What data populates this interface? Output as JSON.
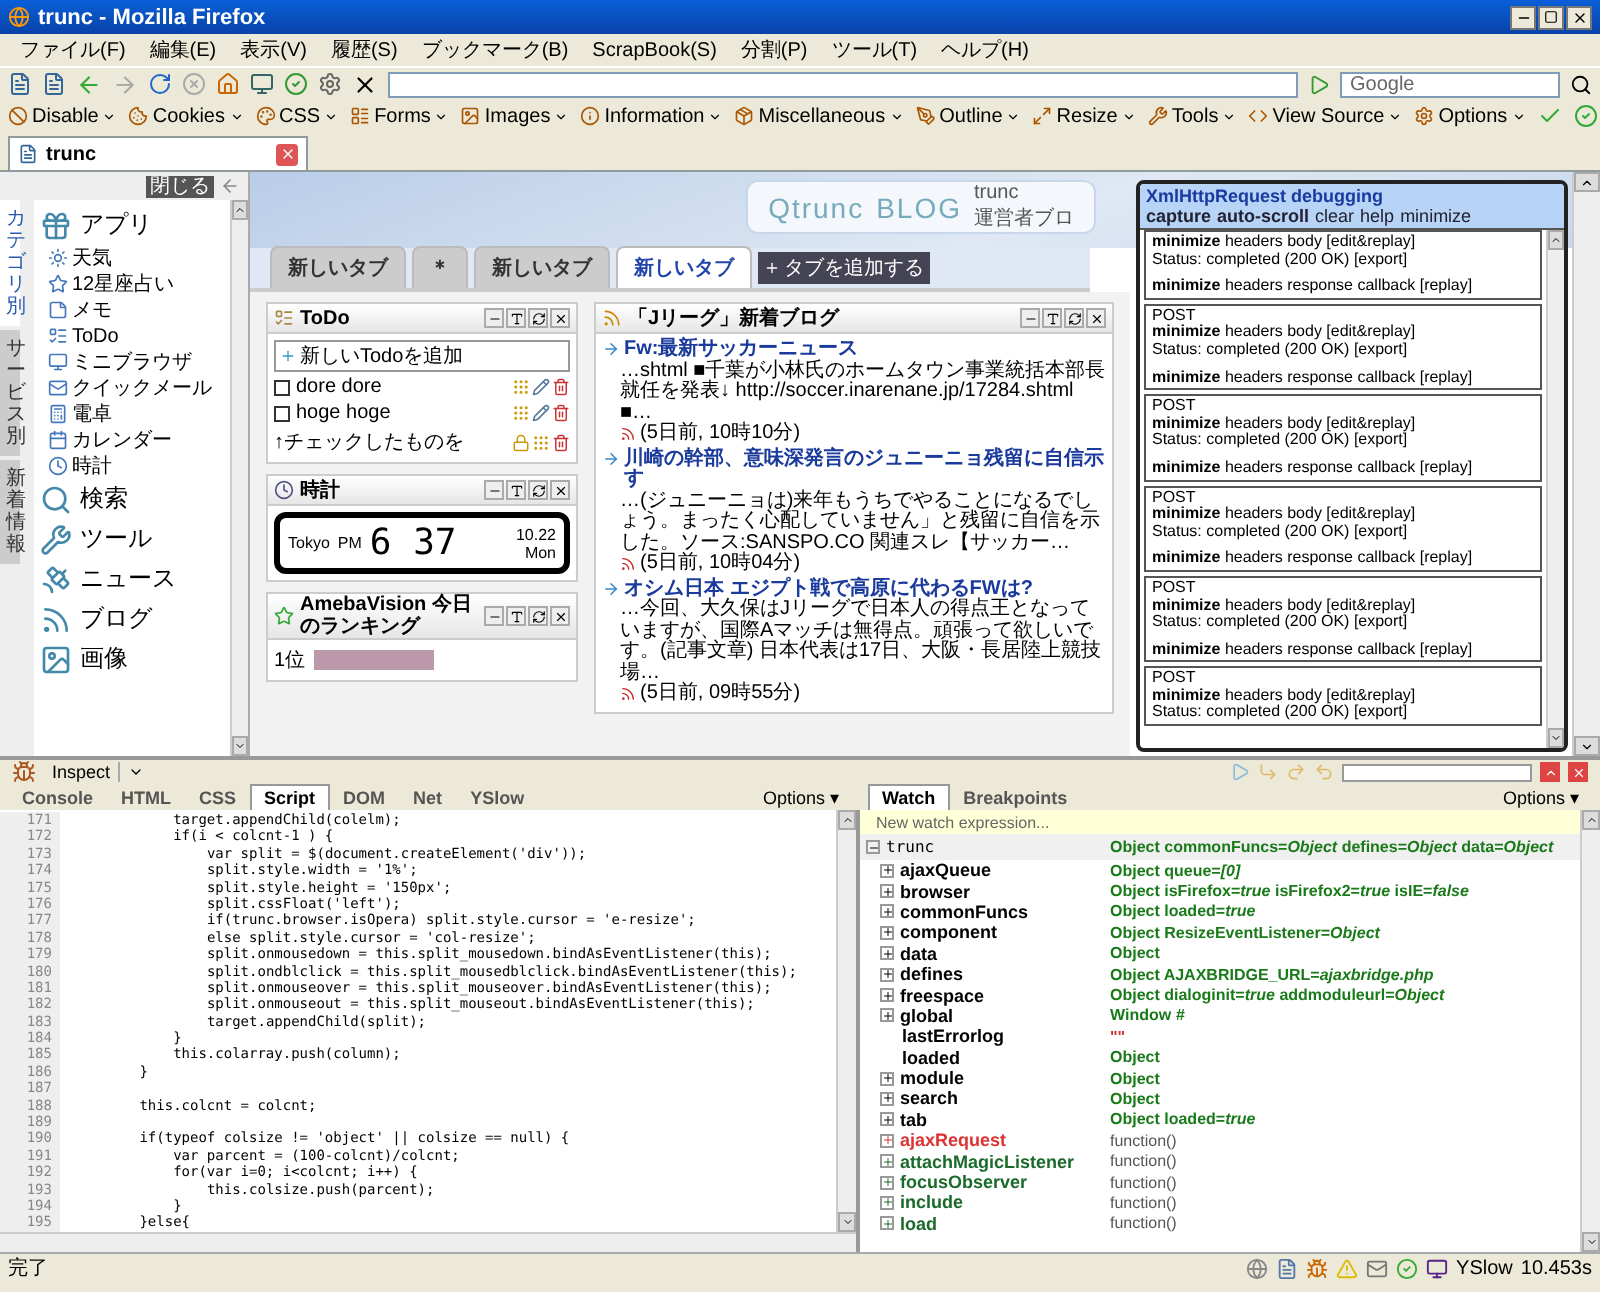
{
  "window": {
    "title": "trunc - Mozilla Firefox"
  },
  "menu": [
    "ファイル(F)",
    "編集(E)",
    "表示(V)",
    "履歴(S)",
    "ブックマーク(B)",
    "ScrapBook(S)",
    "分割(P)",
    "ツール(T)",
    "ヘルプ(H)"
  ],
  "search_box": {
    "placeholder": "Google"
  },
  "dev_toolbar": [
    "Disable",
    "Cookies",
    "CSS",
    "Forms",
    "Images",
    "Information",
    "Miscellaneous",
    "Outline",
    "Resize",
    "Tools",
    "View Source",
    "Options"
  ],
  "browser_tabs": [
    {
      "label": "trunc",
      "selected": true
    }
  ],
  "sidebar": {
    "close_button": "閉じる",
    "tabs": [
      {
        "label": "カテゴリ別",
        "selected": true
      },
      {
        "label": "サービス別",
        "selected": false
      },
      {
        "label": "新着情報",
        "selected": false
      }
    ],
    "sections": [
      {
        "label": "アプリ",
        "children": [
          {
            "label": "天気"
          },
          {
            "label": "12星座占い"
          },
          {
            "label": "メモ"
          },
          {
            "label": "ToDo"
          },
          {
            "label": "ミニブラウザ"
          },
          {
            "label": "クイックメール"
          },
          {
            "label": "電卓"
          },
          {
            "label": "カレンダー"
          },
          {
            "label": "時計"
          }
        ]
      },
      {
        "label": "検索"
      },
      {
        "label": "ツール"
      },
      {
        "label": "ニュース"
      },
      {
        "label": "ブログ"
      },
      {
        "label": "画像"
      }
    ]
  },
  "page": {
    "logo": "Qtrunc",
    "logo_suffix": "BLOG",
    "owner": "trunc",
    "owner_note": "運営者ブロ",
    "tabs": [
      {
        "label": "新しいタブ",
        "selected": false
      },
      {
        "label": "＊",
        "selected": false
      },
      {
        "label": "新しいタブ",
        "selected": false
      },
      {
        "label": "新しいタブ",
        "selected": true
      }
    ],
    "add_tab": "タブを追加する",
    "todo": {
      "title": "ToDo",
      "add": "新しいTodoを追加",
      "items": [
        {
          "label": "dore dore",
          "checked": false
        },
        {
          "label": "hoge hoge",
          "checked": false
        }
      ],
      "footer": "↑チェックしたものを"
    },
    "clock": {
      "title": "時計",
      "city": "Tokyo",
      "ampm": "PM",
      "time": "6 37",
      "date": "10.22",
      "weekday": "Mon"
    },
    "ranking": {
      "title": "AmebaVision 今日のランキング",
      "rank": "1位"
    },
    "blog": {
      "title": "「Jリーグ」新着ブログ",
      "entries": [
        {
          "title": "Fw:最新サッカーニュース",
          "snippet": "…shtml ■千葉が小林氏のホームタウン事業統括本部長就任を発表↓ http://soccer.inarenane.jp/17284.shtml ■…",
          "meta": "(5日前, 10時10分)"
        },
        {
          "title": "川崎の幹部、意味深発言のジュニーニョ残留に自信示す",
          "snippet": "…(ジュニーニョは)来年もうちでやることになるでしょう。まったく心配していません」と残留に自信を示した。ソース:SANSPO.CO 関連スレ【サッカー…",
          "meta": "(5日前, 10時04分)"
        },
        {
          "title": "オシム日本 エジプト戦で高原に代わるFWは?",
          "snippet": "…今回、大久保はJリーグで日本人の得点王となっていますが、国際Aマッチは無得点。頑張って欲しいです。(記事文章) 日本代表は17日、大阪・長居陸上競技場…",
          "meta": "(5日前, 09時55分)"
        }
      ]
    }
  },
  "xhr_panel": {
    "title": "XmlHttpRequest debugging",
    "controls": [
      {
        "label": "capture",
        "on": true
      },
      {
        "label": "auto-scroll",
        "on": true
      },
      {
        "label": "clear",
        "on": false
      },
      {
        "label": "help",
        "on": false
      },
      {
        "label": "minimize",
        "on": false
      }
    ],
    "entries": [
      {
        "actions": "**minimize** headers body [edit&replay]",
        "status": "Status: completed (200 OK) [export]",
        "callback": "**minimize** headers response callback [replay]"
      },
      {
        "request": "POST",
        "actions": "**minimize** headers body [edit&replay]",
        "status": "Status: completed (200 OK) [export]",
        "callback": "**minimize** headers response callback [replay]"
      },
      {
        "request": "POST",
        "actions": "**minimize** headers body [edit&replay]",
        "status": "Status: completed (200 OK) [export]",
        "callback": "**minimize** headers response callback [replay]"
      },
      {
        "request": "POST",
        "actions": "**minimize** headers body [edit&replay]",
        "status": "Status: completed (200 OK) [export]",
        "callback": "**minimize** headers response callback [replay]"
      },
      {
        "request": "POST",
        "actions": "**minimize** headers body [edit&replay]",
        "status": "Status: completed (200 OK) [export]",
        "callback": "**minimize** headers response callback [replay]"
      },
      {
        "request": "POST",
        "actions": "**minimize** headers body [edit&replay]",
        "status": "Status: completed (200 OK) [export]"
      }
    ]
  },
  "firebug": {
    "inspect": "Inspect",
    "tabs": [
      {
        "label": "Console",
        "selected": false
      },
      {
        "label": "HTML",
        "selected": false
      },
      {
        "label": "CSS",
        "selected": false
      },
      {
        "label": "Script",
        "selected": true
      },
      {
        "label": "DOM",
        "selected": false
      },
      {
        "label": "Net",
        "selected": false
      },
      {
        "label": "YSlow",
        "selected": false
      }
    ],
    "options": "Options ▾",
    "code": [
      {
        "number": "171",
        "text": "\t\t\ttarget.appendChild(colelm);"
      },
      {
        "number": "172",
        "text": "\t\t\tif(i < colcnt-1 ) {"
      },
      {
        "number": "173",
        "text": "\t\t\t\tvar split = $(document.createElement('div'));"
      },
      {
        "number": "174",
        "text": "\t\t\t\tsplit.style.width = '1%';"
      },
      {
        "number": "175",
        "text": "\t\t\t\tsplit.style.height = '150px';"
      },
      {
        "number": "176",
        "text": "\t\t\t\tsplit.cssFloat('left');"
      },
      {
        "number": "177",
        "text": "\t\t\t\tif(trunc.browser.isOpera) split.style.cursor = 'e-resize';"
      },
      {
        "number": "178",
        "text": "\t\t\t\telse split.style.cursor = 'col-resize';"
      },
      {
        "number": "179",
        "text": "\t\t\t\tsplit.onmousedown = this.split_mousedown.bindAsEventListener(this);"
      },
      {
        "number": "180",
        "text": "\t\t\t\tsplit.ondblclick = this.split_mousedblclick.bindAsEventListener(this);"
      },
      {
        "number": "181",
        "text": "\t\t\t\tsplit.onmouseover = this.split_mouseover.bindAsEventListener(this);"
      },
      {
        "number": "182",
        "text": "\t\t\t\tsplit.onmouseout = this.split_mouseout.bindAsEventListener(this);"
      },
      {
        "number": "183",
        "text": "\t\t\t\ttarget.appendChild(split);"
      },
      {
        "number": "184",
        "text": "\t\t\t}"
      },
      {
        "number": "185",
        "text": "\t\t\tthis.colarray.push(column);"
      },
      {
        "number": "186",
        "text": "\t\t}"
      },
      {
        "number": "187"
      },
      {
        "number": "188",
        "text": "\t\tthis.colcnt = colcnt;"
      },
      {
        "number": "189"
      },
      {
        "number": "190",
        "text": "\t\tif(typeof colsize != 'object' || colsize == null) {"
      },
      {
        "number": "191",
        "text": "\t\t\tvar parcent = (100-colcnt)/colcnt;"
      },
      {
        "number": "192",
        "text": "\t\t\tfor(var i=0; i<colcnt; i++) {"
      },
      {
        "number": "193",
        "text": "\t\t\t\tthis.colsize.push(parcent);"
      },
      {
        "number": "194",
        "text": "\t\t\t}"
      },
      {
        "number": "195",
        "text": "\t\t}else{"
      }
    ],
    "side_tabs": [
      {
        "label": "Watch",
        "selected": true
      },
      {
        "label": "Breakpoints",
        "selected": false
      }
    ],
    "side_options": "Options ▾",
    "watch_placeholder": "New watch expression...",
    "watch_root": {
      "name": "trunc",
      "expanded": true,
      "value": "Object commonFuncs=*Object* defines=*Object* data=*Object*"
    },
    "watch": [
      {
        "name": "ajaxQueue",
        "kind": "object",
        "expanded": false,
        "value": "Object queue=*[0]*"
      },
      {
        "name": "browser",
        "kind": "object",
        "expanded": false,
        "value": "Object isFirefox=*true* isFirefox2=*true* isIE=*false*"
      },
      {
        "name": "commonFuncs",
        "kind": "object",
        "expanded": false,
        "value": "Object loaded=*true*"
      },
      {
        "name": "component",
        "kind": "object",
        "expanded": false,
        "value": "Object ResizeEventListener=*Object*"
      },
      {
        "name": "data",
        "kind": "object",
        "expanded": false,
        "value": "Object"
      },
      {
        "name": "defines",
        "kind": "object",
        "expanded": false,
        "value": "Object AJAXBRIDGE_URL=*ajaxbridge.php*"
      },
      {
        "name": "freespace",
        "kind": "object",
        "expanded": false,
        "value": "Object dialoginit=*true* addmoduleurl=*Object*"
      },
      {
        "name": "global",
        "kind": "object",
        "expanded": false,
        "value": "Window *#*"
      },
      {
        "name": "lastErrorlog",
        "kind": "string",
        "value": "\"\""
      },
      {
        "name": "loaded",
        "kind": "leaf",
        "value": "Object"
      },
      {
        "name": "module",
        "kind": "object",
        "expanded": false,
        "value": "Object"
      },
      {
        "name": "search",
        "kind": "object",
        "expanded": false,
        "value": "Object"
      },
      {
        "name": "tab",
        "kind": "object",
        "expanded": false,
        "value": "Object loaded=*true*"
      },
      {
        "name": "ajaxRequest",
        "kind": "error",
        "expanded": false,
        "value": "function()"
      },
      {
        "name": "attachMagicListener",
        "kind": "function",
        "expanded": false,
        "value": "function()"
      },
      {
        "name": "focusObserver",
        "kind": "function",
        "expanded": false,
        "value": "function()"
      },
      {
        "name": "include",
        "kind": "function",
        "expanded": false,
        "value": "function()"
      },
      {
        "name": "load",
        "kind": "function",
        "expanded": false,
        "value": "function()"
      }
    ]
  },
  "status_bar": {
    "text": "完了",
    "yslow": "YSlow",
    "time": "10.453s"
  }
}
